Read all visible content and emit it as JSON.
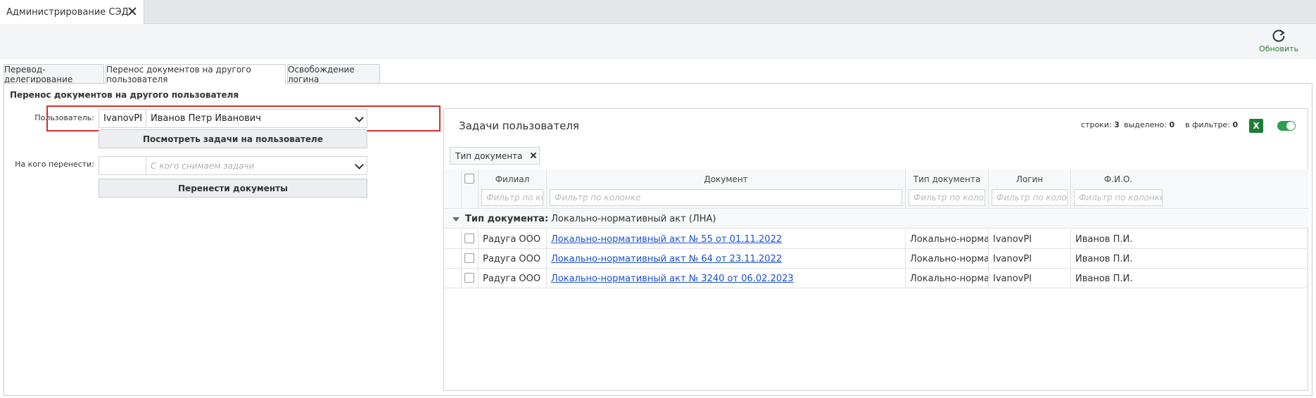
{
  "window_tab": {
    "title": "Администрирование СЭД"
  },
  "toolbar": {
    "refresh_label": "Обновить"
  },
  "tabs": [
    {
      "label": "Перевод-делегирование"
    },
    {
      "label": "Перенос документов на другого пользователя"
    },
    {
      "label": "Освобождение логина"
    }
  ],
  "section_title": "Перенос документов на другого пользователя",
  "form": {
    "user_label": "Пользователь:",
    "user_login": "IvanovPI",
    "user_name": "Иванов Петр Иванович",
    "view_tasks_button": "Посмотреть задачи на пользователе",
    "target_label": "На кого перенести:",
    "target_login": "",
    "target_placeholder": "С кого снимаем задачи",
    "transfer_button": "Перенести документы"
  },
  "panel": {
    "title": "Задачи пользователя",
    "rows_label": "строки:",
    "rows_count": "3",
    "selected_label": "выделено:",
    "selected_count": "0",
    "filter_label": "в фильтре:",
    "filter_count": "0",
    "excel_label": "X",
    "group_chip": "Тип документа"
  },
  "grid": {
    "columns": [
      {
        "title": "Филиал",
        "filter_placeholder": "Фильтр по ко..."
      },
      {
        "title": "Документ",
        "filter_placeholder": "Фильтр по колонке"
      },
      {
        "title": "Тип документа",
        "filter_placeholder": "Фильтр по коло..."
      },
      {
        "title": "Логин",
        "filter_placeholder": "Фильтр по коло..."
      },
      {
        "title": "Ф.И.О.",
        "filter_placeholder": "Фильтр по колонке"
      }
    ],
    "group_label": "Тип документа:",
    "group_value": "Локально-нормативный акт (ЛНА)",
    "rows": [
      {
        "branch": "Радуга ООО",
        "document": "Локально-нормативный акт № 55 от 01.11.2022",
        "doc_type": "Локально-нормат...",
        "login": "IvanovPI",
        "fio": "Иванов П.И."
      },
      {
        "branch": "Радуга ООО",
        "document": "Локально-нормативный акт № 64 от 23.11.2022",
        "doc_type": "Локально-нормат...",
        "login": "IvanovPI",
        "fio": "Иванов П.И."
      },
      {
        "branch": "Радуга ООО",
        "document": "Локально-нормативный акт № 3240 от 06.02.2023",
        "doc_type": "Локально-нормат...",
        "login": "IvanovPI",
        "fio": "Иванов П.И."
      }
    ]
  },
  "colors": {
    "highlight": "#d32f2f",
    "accent_green": "#2e7d32",
    "link": "#1a4fd6"
  }
}
